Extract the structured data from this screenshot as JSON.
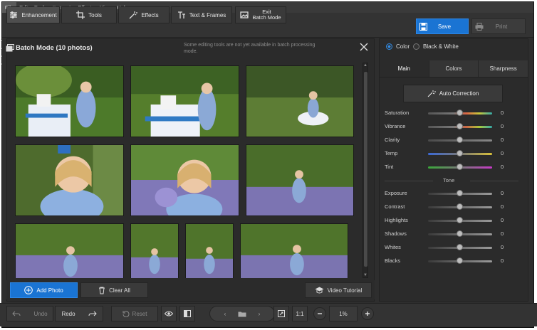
{
  "menu": [
    "File",
    "Edit",
    "Tools",
    "Retouch",
    "Effects",
    "View",
    "Help"
  ],
  "toolbar": {
    "enhancement": "Enhancement",
    "tools": "Tools",
    "effects": "Effects",
    "text_frames": "Text & Frames",
    "exit_line1": "Exit",
    "exit_line2": "Batch Mode",
    "save": "Save",
    "print": "Print"
  },
  "batch": {
    "title": "Batch Mode (10 photos)",
    "note": "Some editing tools are not yet available in batch processing mode.",
    "add_photo": "Add Photo",
    "clear_all": "Clear All",
    "video_tutorial": "Video Tutorial"
  },
  "bottom": {
    "undo": "Undo",
    "redo": "Redo",
    "reset": "Reset",
    "ratio": "1:1",
    "zoom": "1%"
  },
  "panel": {
    "color": "Color",
    "bw": "Black & White",
    "tabs": [
      "Main",
      "Colors",
      "Sharpness"
    ],
    "auto_correction": "Auto Correction",
    "tone": "Tone",
    "sliders": [
      {
        "label": "Saturation",
        "value": "0",
        "kind": "sat"
      },
      {
        "label": "Vibrance",
        "value": "0",
        "kind": "vib"
      },
      {
        "label": "Clarity",
        "value": "0",
        "kind": "gray"
      },
      {
        "label": "Temp",
        "value": "0",
        "kind": "temp"
      },
      {
        "label": "Tint",
        "value": "0",
        "kind": "tint"
      }
    ],
    "tone_sliders": [
      {
        "label": "Exposure",
        "value": "0"
      },
      {
        "label": "Contrast",
        "value": "0"
      },
      {
        "label": "Highlights",
        "value": "0"
      },
      {
        "label": "Shadows",
        "value": "0"
      },
      {
        "label": "Whites",
        "value": "0"
      },
      {
        "label": "Blacks",
        "value": "0"
      }
    ]
  },
  "colors": {
    "accent": "#1a74d3",
    "bg": "#2e2e2e"
  }
}
